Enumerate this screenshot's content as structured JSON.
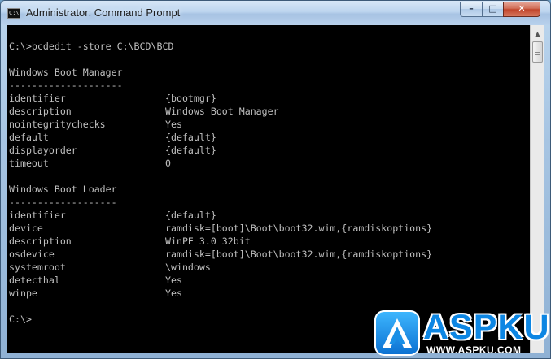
{
  "window": {
    "title": "Administrator: Command Prompt",
    "icon_text": "C:\\",
    "controls": {
      "minimize": "–",
      "maximize": "□",
      "close": "✕"
    }
  },
  "console": {
    "command_line": "C:\\>bcdedit -store C:\\BCD\\BCD",
    "boot_manager": {
      "heading": "Windows Boot Manager",
      "rule": "--------------------",
      "rows": [
        {
          "key": "identifier",
          "value": "{bootmgr}"
        },
        {
          "key": "description",
          "value": "Windows Boot Manager"
        },
        {
          "key": "nointegritychecks",
          "value": "Yes"
        },
        {
          "key": "default",
          "value": "{default}"
        },
        {
          "key": "displayorder",
          "value": "{default}"
        },
        {
          "key": "timeout",
          "value": "0"
        }
      ]
    },
    "boot_loader": {
      "heading": "Windows Boot Loader",
      "rule": "-------------------",
      "rows": [
        {
          "key": "identifier",
          "value": "{default}"
        },
        {
          "key": "device",
          "value": "ramdisk=[boot]\\Boot\\boot32.wim,{ramdiskoptions}"
        },
        {
          "key": "description",
          "value": "WinPE 3.0 32bit"
        },
        {
          "key": "osdevice",
          "value": "ramdisk=[boot]\\Boot\\boot32.wim,{ramdiskoptions}"
        },
        {
          "key": "systemroot",
          "value": "\\windows"
        },
        {
          "key": "detecthal",
          "value": "Yes"
        },
        {
          "key": "winpe",
          "value": "Yes"
        }
      ]
    },
    "prompt": "C:\\>"
  },
  "watermark": {
    "brand": "ASPKU",
    "url": "WWW.ASPKU.COM"
  },
  "colors": {
    "console_bg": "#000000",
    "console_text": "#c0c0c0",
    "brand_blue": "#0d86e3",
    "close_red": "#c1452b"
  }
}
